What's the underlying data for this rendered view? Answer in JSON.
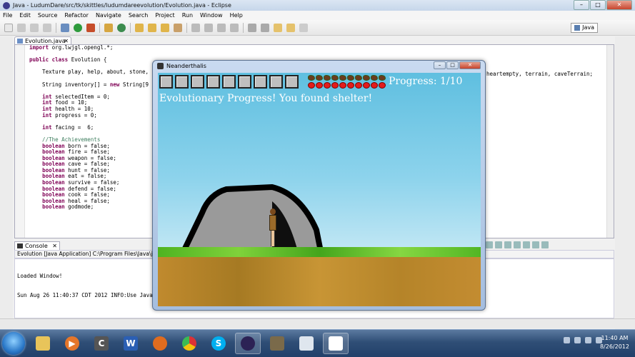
{
  "eclipse": {
    "title": "Java - LudumDare/src/tk/skittles/ludumdareevolution/Evolution.java - Eclipse",
    "menu": [
      "File",
      "Edit",
      "Source",
      "Refactor",
      "Navigate",
      "Search",
      "Project",
      "Run",
      "Window",
      "Help"
    ],
    "perspective": "Java",
    "editor_tab": "Evolution.java",
    "code_lines": [
      "import org.lwjgl.opengl.*;",
      "",
      "public class Evolution {",
      "",
      "    Texture play, help, about, stone,",
      "",
      "    String inventory[] = new String[9",
      "",
      "    int selectedItem = 0;",
      "    int food = 10;",
      "    int health = 10;",
      "    int progress = 0;",
      "",
      "    int facing =  6;",
      "",
      "    //The Achievements",
      "    boolean born = false;",
      "    boolean fire = false;",
      "    boolean weapon = false;",
      "    boolean cave = false;",
      "    boolean hunt = false;",
      "    boolean eat = false;",
      "    boolean survive = false;",
      "    boolean defend = false;",
      "    boolean cook = false;",
      "    boolean heal = false;",
      "    boolean godmode;"
    ],
    "code_right": "heartempty, terrain, caveTerrain;",
    "console_tab": "Console",
    "console_header": "Evolution [Java Application] C:\\Program Files\\Java\\jdk1",
    "console_lines": [
      "Loaded Window!",
      "Sun Aug 26 11:40:37 CDT 2012 INFO:Use Java"
    ]
  },
  "game": {
    "window_title": "Neanderthalis",
    "slot_count": 9,
    "food": 10,
    "health": 10,
    "progress_text": "Progress: 1/10",
    "message": "Evolutionary Progress! You found shelter!",
    "colors": {
      "heart": "#e31b1b",
      "meat": "#6b3b1e",
      "grass": "#4fb321",
      "dirt": "#c08a2e",
      "cave": "#9a9a9a"
    }
  },
  "taskbar": {
    "apps": [
      "explorer",
      "media-player",
      "chrome-c",
      "word",
      "firefox",
      "chrome",
      "skype",
      "eclipse",
      "gimp",
      "document",
      "java-game"
    ],
    "time": "11:40 AM",
    "date": "8/26/2012"
  }
}
